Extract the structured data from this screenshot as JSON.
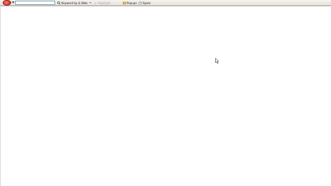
{
  "toolbar": {
    "search": {
      "value": "",
      "placeholder": ""
    },
    "search_button_label": "Keyword by & Web",
    "highlight_label": "Highlight",
    "popups_label": "Popups",
    "spam_label": "Spam"
  },
  "colors": {
    "toolbar_bg": "#e2e0d6",
    "logo_red": "#c0201a",
    "content_bg": "#ffffff"
  },
  "icons": [
    "toolbar-logo-icon",
    "search-icon",
    "highlight-icon",
    "popup-blocker-icon",
    "spam-icon",
    "mouse-cursor-icon"
  ]
}
